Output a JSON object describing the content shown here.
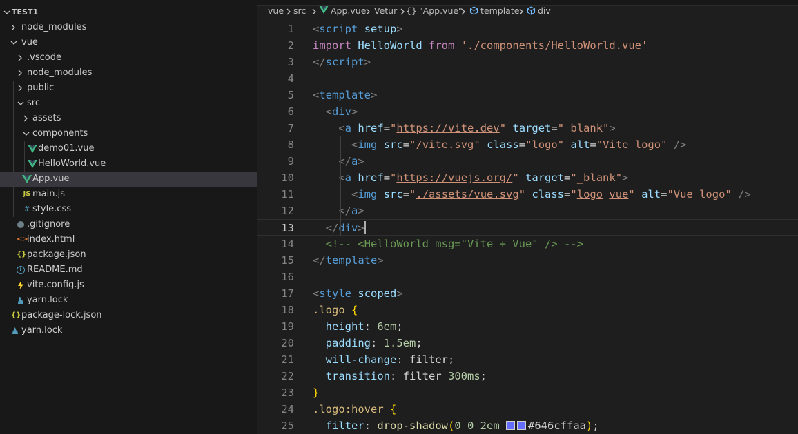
{
  "explorer": {
    "items": [
      {
        "label": "TEST1",
        "depth": 0,
        "kind": "folder",
        "open": true
      },
      {
        "label": "node_modules",
        "depth": 1,
        "kind": "folder",
        "open": false
      },
      {
        "label": "vue",
        "depth": 1,
        "kind": "folder",
        "open": true
      },
      {
        "label": ".vscode",
        "depth": 2,
        "kind": "folder",
        "open": false
      },
      {
        "label": "node_modules",
        "depth": 2,
        "kind": "folder",
        "open": false
      },
      {
        "label": "public",
        "depth": 2,
        "kind": "folder",
        "open": false
      },
      {
        "label": "src",
        "depth": 2,
        "kind": "folder",
        "open": true
      },
      {
        "label": "assets",
        "depth": 3,
        "kind": "folder",
        "open": false
      },
      {
        "label": "components",
        "depth": 3,
        "kind": "folder",
        "open": true
      },
      {
        "label": "demo01.vue",
        "depth": 4,
        "kind": "vue"
      },
      {
        "label": "HelloWorld.vue",
        "depth": 4,
        "kind": "vue"
      },
      {
        "label": "App.vue",
        "depth": 3,
        "kind": "vue",
        "selected": true
      },
      {
        "label": "main.js",
        "depth": 3,
        "kind": "js",
        "icon_text": "JS"
      },
      {
        "label": "style.css",
        "depth": 3,
        "kind": "css",
        "icon_text": "#"
      },
      {
        "label": ".gitignore",
        "depth": 2,
        "kind": "git"
      },
      {
        "label": "index.html",
        "depth": 2,
        "kind": "html",
        "icon_text": "<>"
      },
      {
        "label": "package.json",
        "depth": 2,
        "kind": "json",
        "icon_text": "{}"
      },
      {
        "label": "README.md",
        "depth": 2,
        "kind": "info",
        "icon_text": "i"
      },
      {
        "label": "vite.config.js",
        "depth": 2,
        "kind": "vite"
      },
      {
        "label": "yarn.lock",
        "depth": 2,
        "kind": "yarn"
      },
      {
        "label": "package-lock.json",
        "depth": 1,
        "kind": "json",
        "icon_text": "{}"
      },
      {
        "label": "yarn.lock",
        "depth": 1,
        "kind": "yarn"
      }
    ]
  },
  "breadcrumb": {
    "items": [
      {
        "label": "vue"
      },
      {
        "label": "src"
      },
      {
        "label": "App.vue",
        "icon": "vue-icon"
      },
      {
        "label": "Vetur"
      },
      {
        "label": "\"App.vue\"",
        "icon": "braces-icon",
        "icon_text": "{}"
      },
      {
        "label": "template",
        "icon": "cube-icon"
      },
      {
        "label": "div",
        "icon": "cube-icon"
      }
    ]
  },
  "editor": {
    "current_line": 13,
    "lines": [
      {
        "n": "1",
        "tokens": [
          [
            "<",
            "p"
          ],
          [
            "script",
            "t"
          ],
          [
            " ",
            ""
          ],
          [
            "setup",
            "a"
          ],
          [
            ">",
            "p"
          ]
        ]
      },
      {
        "n": "2",
        "tokens": [
          [
            "import",
            "k"
          ],
          [
            " ",
            ""
          ],
          [
            "HelloWorld",
            "v"
          ],
          [
            " ",
            ""
          ],
          [
            "from",
            "k"
          ],
          [
            " ",
            ""
          ],
          [
            "'./components/HelloWorld.vue'",
            "s"
          ]
        ]
      },
      {
        "n": "3",
        "tokens": [
          [
            "</",
            "p"
          ],
          [
            "script",
            "t"
          ],
          [
            ">",
            "p"
          ]
        ]
      },
      {
        "n": "4",
        "tokens": []
      },
      {
        "n": "5",
        "tokens": [
          [
            "<",
            "p"
          ],
          [
            "template",
            "t"
          ],
          [
            ">",
            "p"
          ]
        ]
      },
      {
        "n": "6",
        "tokens": [
          [
            "  ",
            ""
          ],
          [
            "<",
            "p"
          ],
          [
            "div",
            "t"
          ],
          [
            ">",
            "p"
          ]
        ]
      },
      {
        "n": "7",
        "tokens": [
          [
            "    ",
            ""
          ],
          [
            "<",
            "p"
          ],
          [
            "a",
            "t"
          ],
          [
            " ",
            ""
          ],
          [
            "href",
            "a"
          ],
          [
            "=",
            "w"
          ],
          [
            "\"",
            "s"
          ],
          [
            "https://vite.dev",
            "su"
          ],
          [
            "\"",
            "s"
          ],
          [
            " ",
            ""
          ],
          [
            "target",
            "a"
          ],
          [
            "=",
            "w"
          ],
          [
            "\"_blank\"",
            "s"
          ],
          [
            ">",
            "p"
          ]
        ]
      },
      {
        "n": "8",
        "tokens": [
          [
            "      ",
            ""
          ],
          [
            "<",
            "p"
          ],
          [
            "img",
            "t"
          ],
          [
            " ",
            ""
          ],
          [
            "src",
            "a"
          ],
          [
            "=",
            "w"
          ],
          [
            "\"",
            "s"
          ],
          [
            "/vite.svg",
            "su"
          ],
          [
            "\"",
            "s"
          ],
          [
            " ",
            ""
          ],
          [
            "class",
            "a"
          ],
          [
            "=",
            "w"
          ],
          [
            "\"",
            "s"
          ],
          [
            "logo",
            "su"
          ],
          [
            "\"",
            "s"
          ],
          [
            " ",
            ""
          ],
          [
            "alt",
            "a"
          ],
          [
            "=",
            "w"
          ],
          [
            "\"Vite logo\"",
            "s"
          ],
          [
            " ",
            ""
          ],
          [
            "/>",
            "p"
          ]
        ]
      },
      {
        "n": "9",
        "tokens": [
          [
            "    ",
            ""
          ],
          [
            "</",
            "p"
          ],
          [
            "a",
            "t"
          ],
          [
            ">",
            "p"
          ]
        ]
      },
      {
        "n": "10",
        "tokens": [
          [
            "    ",
            ""
          ],
          [
            "<",
            "p"
          ],
          [
            "a",
            "t"
          ],
          [
            " ",
            ""
          ],
          [
            "href",
            "a"
          ],
          [
            "=",
            "w"
          ],
          [
            "\"",
            "s"
          ],
          [
            "https://vuejs.org/",
            "su"
          ],
          [
            "\"",
            "s"
          ],
          [
            " ",
            ""
          ],
          [
            "target",
            "a"
          ],
          [
            "=",
            "w"
          ],
          [
            "\"_blank\"",
            "s"
          ],
          [
            ">",
            "p"
          ]
        ]
      },
      {
        "n": "11",
        "tokens": [
          [
            "      ",
            ""
          ],
          [
            "<",
            "p"
          ],
          [
            "img",
            "t"
          ],
          [
            " ",
            ""
          ],
          [
            "src",
            "a"
          ],
          [
            "=",
            "w"
          ],
          [
            "\"",
            "s"
          ],
          [
            "./assets/vue.svg",
            "su"
          ],
          [
            "\"",
            "s"
          ],
          [
            " ",
            ""
          ],
          [
            "class",
            "a"
          ],
          [
            "=",
            "w"
          ],
          [
            "\"",
            "s"
          ],
          [
            "logo",
            "su"
          ],
          [
            " ",
            "s"
          ],
          [
            "vue",
            "su"
          ],
          [
            "\"",
            "s"
          ],
          [
            " ",
            ""
          ],
          [
            "alt",
            "a"
          ],
          [
            "=",
            "w"
          ],
          [
            "\"Vue logo\"",
            "s"
          ],
          [
            " ",
            ""
          ],
          [
            "/>",
            "p"
          ]
        ]
      },
      {
        "n": "12",
        "tokens": [
          [
            "    ",
            ""
          ],
          [
            "</",
            "p"
          ],
          [
            "a",
            "t"
          ],
          [
            ">",
            "p"
          ]
        ]
      },
      {
        "n": "13",
        "tokens": [
          [
            "  ",
            ""
          ],
          [
            "</",
            "p"
          ],
          [
            "div",
            "t"
          ],
          [
            ">",
            "p"
          ]
        ],
        "cursor": true
      },
      {
        "n": "14",
        "tokens": [
          [
            "  ",
            ""
          ],
          [
            "<!-- <HelloWorld msg=\"Vite + Vue\" /> -->",
            "c"
          ]
        ]
      },
      {
        "n": "15",
        "tokens": [
          [
            "</",
            "p"
          ],
          [
            "template",
            "t"
          ],
          [
            ">",
            "p"
          ]
        ]
      },
      {
        "n": "16",
        "tokens": []
      },
      {
        "n": "17",
        "tokens": [
          [
            "<",
            "p"
          ],
          [
            "style",
            "t"
          ],
          [
            " ",
            ""
          ],
          [
            "scoped",
            "a"
          ],
          [
            ">",
            "p"
          ]
        ]
      },
      {
        "n": "18",
        "tokens": [
          [
            ".logo",
            "sel"
          ],
          [
            " ",
            ""
          ],
          [
            "{",
            "b"
          ]
        ]
      },
      {
        "n": "19",
        "tokens": [
          [
            "  ",
            ""
          ],
          [
            "height",
            "prop"
          ],
          [
            ": ",
            "w"
          ],
          [
            "6em",
            "num"
          ],
          [
            ";",
            "w"
          ]
        ]
      },
      {
        "n": "20",
        "tokens": [
          [
            "  ",
            ""
          ],
          [
            "padding",
            "prop"
          ],
          [
            ": ",
            "w"
          ],
          [
            "1.5em",
            "num"
          ],
          [
            ";",
            "w"
          ]
        ]
      },
      {
        "n": "21",
        "tokens": [
          [
            "  ",
            ""
          ],
          [
            "will-change",
            "prop"
          ],
          [
            ": ",
            "w"
          ],
          [
            "filter",
            "w"
          ],
          [
            ";",
            "w"
          ]
        ]
      },
      {
        "n": "22",
        "tokens": [
          [
            "  ",
            ""
          ],
          [
            "transition",
            "prop"
          ],
          [
            ": ",
            "w"
          ],
          [
            "filter ",
            "w"
          ],
          [
            "300ms",
            "num"
          ],
          [
            ";",
            "w"
          ]
        ]
      },
      {
        "n": "23",
        "tokens": [
          [
            "}",
            "b"
          ]
        ]
      },
      {
        "n": "24",
        "tokens": [
          [
            ".logo:hover",
            "sel"
          ],
          [
            " ",
            ""
          ],
          [
            "{",
            "b"
          ]
        ]
      },
      {
        "n": "25",
        "tokens": [
          [
            "  ",
            ""
          ],
          [
            "filter",
            "prop"
          ],
          [
            ": ",
            "w"
          ],
          [
            "drop-shadow",
            "fn"
          ],
          [
            "(",
            "b"
          ],
          [
            "0 0 ",
            "num"
          ],
          [
            "2em",
            "num"
          ],
          [
            " ",
            ""
          ],
          [
            "#swatch",
            "sw"
          ],
          [
            "#swatch",
            "sw"
          ],
          [
            "#646cffaa",
            "w"
          ],
          [
            ")",
            "b"
          ],
          [
            ";",
            "w"
          ]
        ]
      }
    ]
  },
  "colors": {
    "p": "#808080",
    "t": "#569cd6",
    "a": "#9cdcfe",
    "s": "#ce9178",
    "su": "#ce9178",
    "k": "#c586c0",
    "v": "#9cdcfe",
    "w": "#d4d4d4",
    "c": "#6a9955",
    "sel": "#d7ba7d",
    "b": "#ffd700",
    "prop": "#9cdcfe",
    "num": "#b5cea8",
    "fn": "#dcdcaa",
    "vue": "#41b883",
    "js": "#cbcb41",
    "css": "#519aba",
    "html": "#e37933",
    "json": "#cbcb41",
    "info": "#519aba",
    "vite": "#ffd62e",
    "yarn": "#519aba",
    "git": "#6d8086"
  }
}
